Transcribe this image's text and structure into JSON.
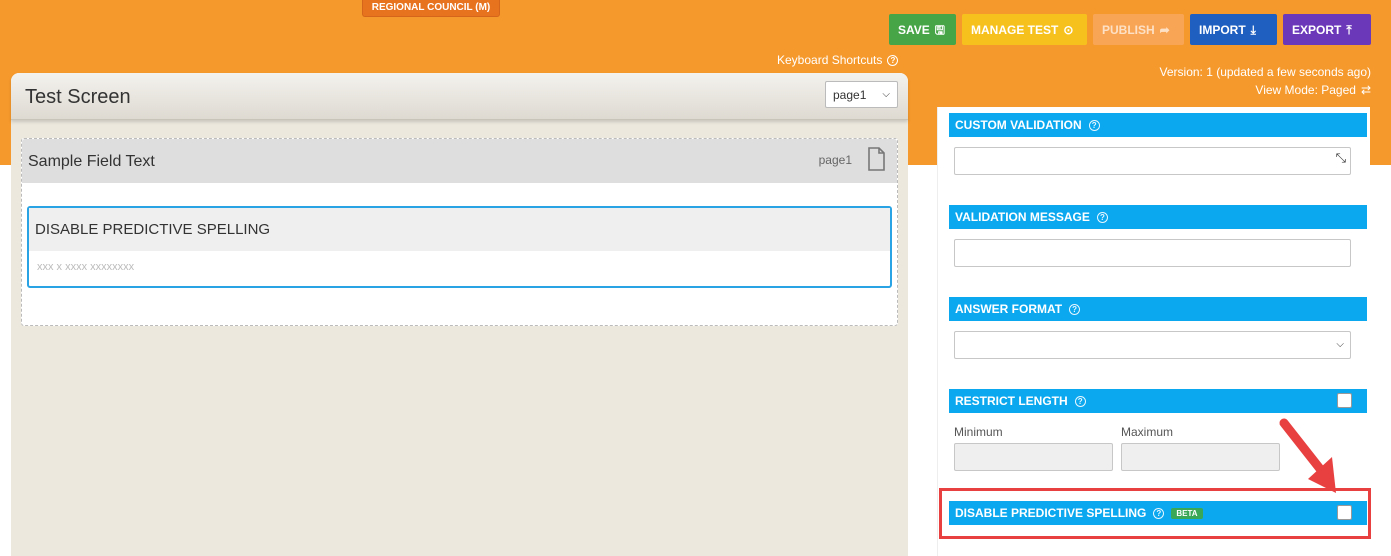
{
  "org_badge": "REGIONAL COUNCIL (M)",
  "toolbar": {
    "save": "SAVE",
    "manage_test": "MANAGE TEST",
    "publish": "PUBLISH",
    "import": "IMPORT",
    "export": "EXPORT"
  },
  "keyboard_shortcuts": "Keyboard Shortcuts",
  "version": "Version: 1 (updated a few seconds ago)",
  "view_mode": "View Mode: Paged",
  "screen": {
    "title": "Test Screen",
    "page_select": "page1"
  },
  "page_card": {
    "title": "Sample Field Text",
    "page_label": "page1"
  },
  "field": {
    "label": "DISABLE PREDICTIVE SPELLING",
    "placeholder": "xxx x xxxx xxxxxxxx"
  },
  "props": {
    "custom_validation": "CUSTOM VALIDATION",
    "validation_message": "VALIDATION MESSAGE",
    "answer_format": "ANSWER FORMAT",
    "restrict_length": "RESTRICT LENGTH",
    "minimum": "Minimum",
    "maximum": "Maximum",
    "disable_predictive_spelling": "DISABLE PREDICTIVE SPELLING",
    "beta": "BETA"
  },
  "colors": {
    "brand_orange": "#f6992c",
    "section_blue": "#0ba8ef",
    "highlight_red": "#e84040"
  }
}
